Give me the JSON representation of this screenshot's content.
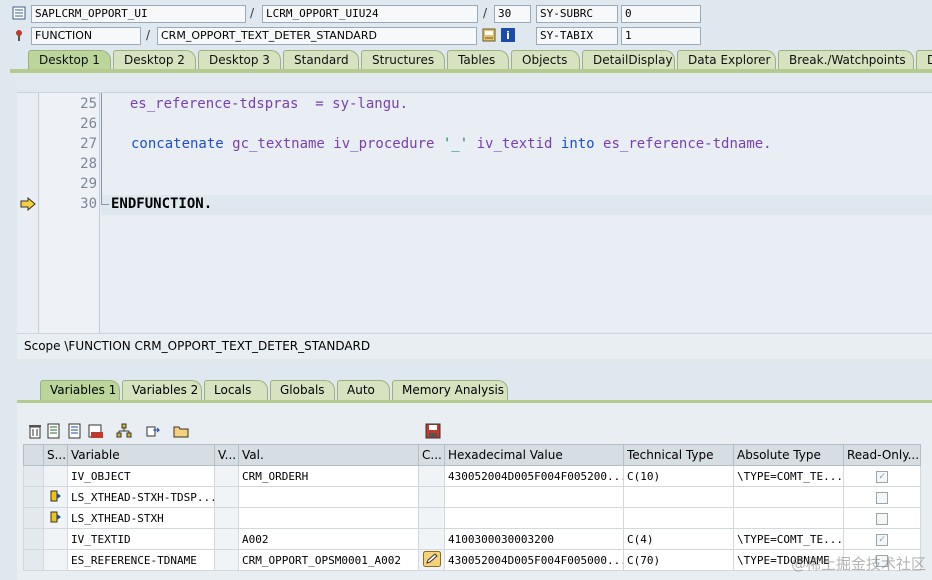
{
  "header": {
    "row1": {
      "program": "SAPLCRM_OPPORT_UI",
      "include": "LCRM_OPPORT_UIU24",
      "line": "30",
      "sysvar": "SY-SUBRC",
      "sysval": "0"
    },
    "row2": {
      "type": "FUNCTION",
      "name": "CRM_OPPORT_TEXT_DETER_STANDARD",
      "sysvar": "SY-TABIX",
      "sysval": "1"
    },
    "sep": "/"
  },
  "tabs": [
    "Desktop 1",
    "Desktop 2",
    "Desktop 3",
    "Standard",
    "Structures",
    "Tables",
    "Objects",
    "DetailDisplay",
    "Data Explorer",
    "Break./Watchpoints",
    "D"
  ],
  "editor": {
    "lines": [
      {
        "no": "25",
        "code": "  es_reference-tdspras  = sy-langu."
      },
      {
        "no": "26",
        "code": ""
      },
      {
        "no": "27",
        "code": ""
      },
      {
        "no": "28",
        "code": ""
      },
      {
        "no": "29",
        "code": ""
      },
      {
        "no": "30",
        "code": ""
      }
    ],
    "line27_parts": [
      "concatenate",
      " gc_textname iv_procedure ",
      "'_'",
      " iv_textid ",
      "into",
      " es_reference-tdname."
    ],
    "line30": "ENDFUNCTION."
  },
  "scope": "Scope \\FUNCTION CRM_OPPORT_TEXT_DETER_STANDARD",
  "lower_tabs": [
    "Variables 1",
    "Variables 2",
    "Locals",
    "Globals",
    "Auto",
    "Memory Analysis"
  ],
  "grid": {
    "columns": [
      "S...",
      "Variable",
      "V...",
      "Val.",
      "C...",
      "Hexadecimal Value",
      "Technical Type",
      "Absolute Type",
      "Read-Only..."
    ],
    "rows": [
      {
        "var": "IV_OBJECT",
        "val": "CRM_ORDERH",
        "hex": "430052004D005F004F005200...",
        "ttype": "C(10)",
        "atype": "\\TYPE=COMT_TE...",
        "ro": true
      },
      {
        "var": "LS_XTHEAD-STXH-TDSP...",
        "val": "",
        "hex": "",
        "ttype": "",
        "atype": "",
        "ro": false
      },
      {
        "var": "LS_XTHEAD-STXH",
        "val": "",
        "hex": "",
        "ttype": "",
        "atype": "",
        "ro": false
      },
      {
        "var": "IV_TEXTID",
        "val": "A002",
        "hex": "4100300030003200",
        "ttype": "C(4)",
        "atype": "\\TYPE=COMT_TE...",
        "ro": true
      },
      {
        "var": "ES_REFERENCE-TDNAME",
        "val": "CRM_OPPORT_OPSM0001_A002",
        "hex": "430052004D005F004F005000...",
        "ttype": "C(70)",
        "atype": "\\TYPE=TDOBNAME",
        "ro": false
      }
    ]
  },
  "watermark": "@稀土掘金技术社区"
}
